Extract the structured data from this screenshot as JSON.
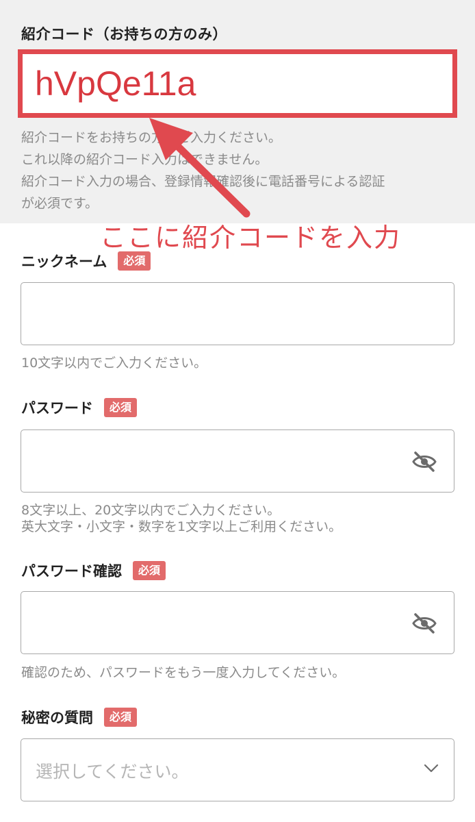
{
  "referral": {
    "label": "紹介コード（お持ちの方のみ）",
    "value": "hVpQe11a",
    "notes": [
      "紹介コードをお持ちの方はご入力ください。",
      "これ以降の紹介コード入力はできません。",
      "紹介コード入力の場合、登録情報確認後に電話番号による認証",
      "が必須です。"
    ]
  },
  "annotation": {
    "text": "ここに紹介コードを入力",
    "color": "#e0494f"
  },
  "required_badge": "必須",
  "nickname": {
    "label": "ニックネーム",
    "value": "",
    "helper": "10文字以内でご入力ください。"
  },
  "password": {
    "label": "パスワード",
    "value": "",
    "helper_lines": [
      "8文字以上、20文字以内でご入力ください。",
      "英大文字・小文字・数字を1文字以上ご利用ください。"
    ],
    "icon": "eye-slash-icon"
  },
  "password_confirm": {
    "label": "パスワード確認",
    "value": "",
    "helper": "確認のため、パスワードをもう一度入力してください。",
    "icon": "eye-slash-icon"
  },
  "secret_question": {
    "label": "秘密の質問",
    "placeholder": "選択してください。",
    "icon": "chevron-down-icon"
  },
  "colors": {
    "accent": "#e0494f",
    "badge": "#e26b6b",
    "section_bg": "#f0f0f0",
    "helper_text": "#8a8a8a"
  }
}
